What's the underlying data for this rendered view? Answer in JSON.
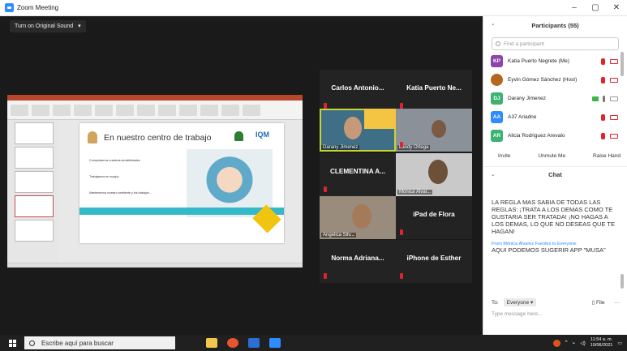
{
  "window": {
    "title": "Zoom Meeting",
    "controls": [
      "–",
      "▢",
      "✕"
    ]
  },
  "toolbar": {
    "sound_label": "Turn on Original Sound",
    "sound_chevron": "▾"
  },
  "share": {
    "slide_title": "En nuestro centro de trabajo",
    "logo_text": "IQM",
    "bullets": [
      "Comportarnos nuestras sensibilidades",
      "Trabajamos en equipo",
      "Mantenemos nuestro ambiente y los trabajos..."
    ]
  },
  "tiles": [
    {
      "name": "Carlos  Antonio...",
      "label": ""
    },
    {
      "name": "Katia Puerto Ne...",
      "label": ""
    },
    {
      "name": "",
      "label": "Darany Jimenez"
    },
    {
      "name": "",
      "label": "Landy Ortega"
    },
    {
      "name": "CLEMENTINA A...",
      "label": ""
    },
    {
      "name": "",
      "label": "Mónica Álvar..."
    },
    {
      "name": "",
      "label": "Angelica Silv..."
    },
    {
      "name": "iPad de Flora",
      "label": ""
    },
    {
      "name": "Norma Adriana...",
      "label": ""
    },
    {
      "name": "iPhone de Esther",
      "label": ""
    }
  ],
  "participants": {
    "header": "Participants (55)",
    "find_placeholder": "Find a participant",
    "list": [
      {
        "initials": "KP",
        "name": "Katia Puerto Negrete (Me)",
        "color": "#8e44ad"
      },
      {
        "initials": "",
        "name": "Eyvin Gómez Sánchez (Host)",
        "color": "#b5651d"
      },
      {
        "initials": "DJ",
        "name": "Darany Jimenez",
        "color": "#3cb371"
      },
      {
        "initials": "AA",
        "name": "A37 Ariadne",
        "color": "#2d8cff"
      },
      {
        "initials": "AR",
        "name": "Alicia Rodriguez Arevalo",
        "color": "#3cb371"
      }
    ],
    "buttons": [
      "Invite",
      "Unmute Me",
      "Raise Hand"
    ]
  },
  "chat": {
    "header": "Chat",
    "messages": [
      {
        "from": "",
        "text": "LA REGLA MAS SABIA DE TODAS LAS REGLAS: ¡TRATA A LOS DEMAS COMO TE GUSTARIA SER TRATADA! ¡NO HAGAS A LOS DEMAS, LO QUE NO DESEAS QUE TE HAGAN!"
      },
      {
        "from": "From Mónica Álvarez Fuentes to Everyone:",
        "text": "AQUI PODEMOS SUGERIR APP \"MUSA\""
      }
    ],
    "first_from": "From Mónica Álvarez Fuentes to Everyone:",
    "to_label": "To:",
    "to_value": "Everyone ▾",
    "file_label": "File",
    "more": "···",
    "placeholder": "Type message here..."
  },
  "taskbar": {
    "search_placeholder": "Escribe aquí para buscar",
    "time": "11:54 a. m.",
    "date": "10/06/2021"
  }
}
